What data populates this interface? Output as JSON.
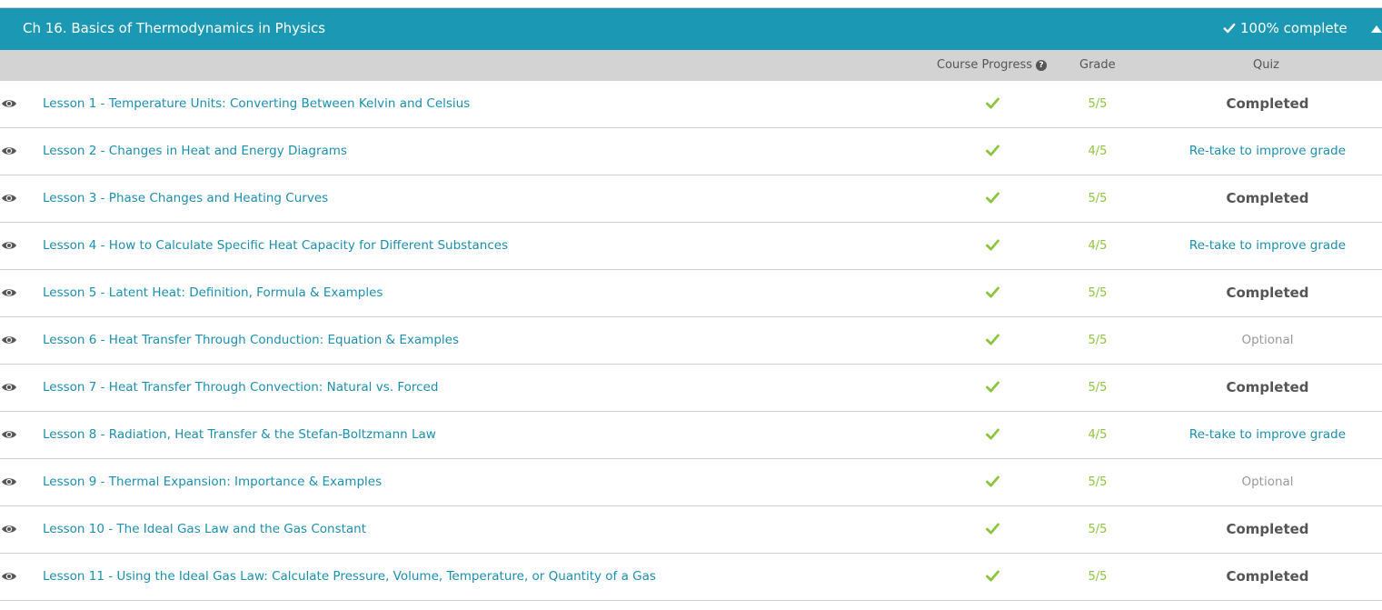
{
  "chapter": {
    "title": "Ch 16. Basics of Thermodynamics in Physics",
    "completion": "100% complete",
    "header_color": "#1b98b3"
  },
  "columns": {
    "progress": "Course Progress",
    "grade": "Grade",
    "quiz": "Quiz"
  },
  "colors": {
    "link": "#1b8fae",
    "check": "#8cc63f",
    "grade": "#8cc63f",
    "completed": "#555555",
    "optional": "#999999"
  },
  "lessons": [
    {
      "title": "Lesson 1 - Temperature Units: Converting Between Kelvin and Celsius",
      "grade": "5/5",
      "quiz": "Completed",
      "quiz_type": "completed"
    },
    {
      "title": "Lesson 2 - Changes in Heat and Energy Diagrams",
      "grade": "4/5",
      "quiz": "Re-take to improve grade",
      "quiz_type": "retake"
    },
    {
      "title": "Lesson 3 - Phase Changes and Heating Curves",
      "grade": "5/5",
      "quiz": "Completed",
      "quiz_type": "completed"
    },
    {
      "title": "Lesson 4 - How to Calculate Specific Heat Capacity for Different Substances",
      "grade": "4/5",
      "quiz": "Re-take to improve grade",
      "quiz_type": "retake"
    },
    {
      "title": "Lesson 5 - Latent Heat: Definition, Formula & Examples",
      "grade": "5/5",
      "quiz": "Completed",
      "quiz_type": "completed"
    },
    {
      "title": "Lesson 6 - Heat Transfer Through Conduction: Equation & Examples",
      "grade": "5/5",
      "quiz": "Optional",
      "quiz_type": "optional"
    },
    {
      "title": "Lesson 7 - Heat Transfer Through Convection: Natural vs. Forced",
      "grade": "5/5",
      "quiz": "Completed",
      "quiz_type": "completed"
    },
    {
      "title": "Lesson 8 - Radiation, Heat Transfer & the Stefan-Boltzmann Law",
      "grade": "4/5",
      "quiz": "Re-take to improve grade",
      "quiz_type": "retake"
    },
    {
      "title": "Lesson 9 - Thermal Expansion: Importance & Examples",
      "grade": "5/5",
      "quiz": "Optional",
      "quiz_type": "optional"
    },
    {
      "title": "Lesson 10 - The Ideal Gas Law and the Gas Constant",
      "grade": "5/5",
      "quiz": "Completed",
      "quiz_type": "completed"
    },
    {
      "title": "Lesson 11 - Using the Ideal Gas Law: Calculate Pressure, Volume, Temperature, or Quantity of a Gas",
      "grade": "5/5",
      "quiz": "Completed",
      "quiz_type": "completed"
    }
  ]
}
